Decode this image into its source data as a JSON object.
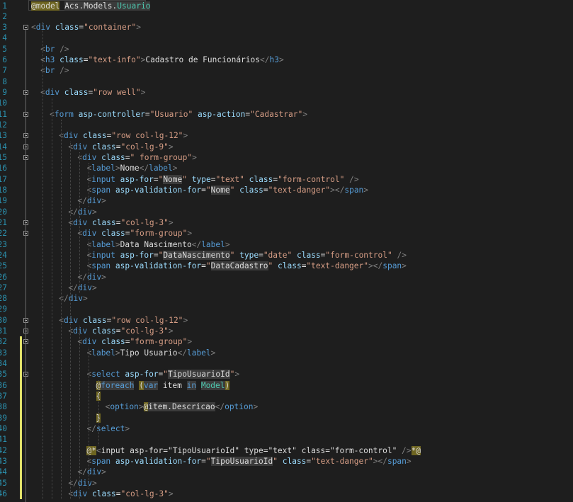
{
  "editor": {
    "line_numbers": [
      "1",
      "2",
      "3",
      "4",
      "5",
      "6",
      "7",
      "8",
      "9",
      "10",
      "11",
      "12",
      "13",
      "14",
      "15",
      "16",
      "17",
      "18",
      "19",
      "20",
      "21",
      "22",
      "23",
      "24",
      "25",
      "26",
      "27",
      "28",
      "29",
      "30",
      "31",
      "32",
      "33",
      "34",
      "35",
      "36",
      "37",
      "38",
      "39",
      "40",
      "41",
      "42",
      "43",
      "44",
      "45",
      "46"
    ],
    "lines": [
      [
        [
          "y",
          "@model"
        ],
        [
          "x",
          " "
        ],
        [
          "r",
          "Acs.Models."
        ],
        [
          "cr",
          "Usuario"
        ]
      ],
      [],
      [
        [
          "p",
          "<"
        ],
        [
          "t",
          "div"
        ],
        [
          "x",
          " "
        ],
        [
          "a",
          "class"
        ],
        [
          "x",
          "="
        ],
        [
          "s",
          "\"container\""
        ],
        [
          "p",
          ">"
        ]
      ],
      [],
      [
        [
          "p",
          "<"
        ],
        [
          "t",
          "br"
        ],
        [
          "x",
          " "
        ],
        [
          "p",
          "/>"
        ]
      ],
      [
        [
          "p",
          "<"
        ],
        [
          "t",
          "h3"
        ],
        [
          "x",
          " "
        ],
        [
          "a",
          "class"
        ],
        [
          "x",
          "="
        ],
        [
          "s",
          "\"text-info\""
        ],
        [
          "p",
          ">"
        ],
        [
          "x",
          "Cadastro de Funcionários"
        ],
        [
          "p",
          "</"
        ],
        [
          "t",
          "h3"
        ],
        [
          "p",
          ">"
        ]
      ],
      [
        [
          "p",
          "<"
        ],
        [
          "t",
          "br"
        ],
        [
          "x",
          " "
        ],
        [
          "p",
          "/>"
        ]
      ],
      [],
      [
        [
          "p",
          "<"
        ],
        [
          "t",
          "div"
        ],
        [
          "x",
          " "
        ],
        [
          "a",
          "class"
        ],
        [
          "x",
          "="
        ],
        [
          "s",
          "\"row well\""
        ],
        [
          "p",
          ">"
        ]
      ],
      [],
      [
        [
          "p",
          "<"
        ],
        [
          "t",
          "form"
        ],
        [
          "x",
          " "
        ],
        [
          "a",
          "asp-controller"
        ],
        [
          "x",
          "="
        ],
        [
          "s",
          "\"Usuario\""
        ],
        [
          "x",
          " "
        ],
        [
          "a",
          "asp-action"
        ],
        [
          "x",
          "="
        ],
        [
          "s",
          "\"Cadastrar\""
        ],
        [
          "p",
          ">"
        ]
      ],
      [],
      [
        [
          "p",
          "<"
        ],
        [
          "t",
          "div"
        ],
        [
          "x",
          " "
        ],
        [
          "a",
          "class"
        ],
        [
          "x",
          "="
        ],
        [
          "s",
          "\"row col-lg-12\""
        ],
        [
          "p",
          ">"
        ]
      ],
      [
        [
          "p",
          "<"
        ],
        [
          "t",
          "div"
        ],
        [
          "x",
          " "
        ],
        [
          "a",
          "class"
        ],
        [
          "x",
          "="
        ],
        [
          "s",
          "\"col-lg-9\""
        ],
        [
          "p",
          ">"
        ]
      ],
      [
        [
          "p",
          "<"
        ],
        [
          "t",
          "div"
        ],
        [
          "x",
          " "
        ],
        [
          "a",
          "class"
        ],
        [
          "x",
          "="
        ],
        [
          "s",
          "\" form-group\""
        ],
        [
          "p",
          ">"
        ]
      ],
      [
        [
          "p",
          "<"
        ],
        [
          "t",
          "label"
        ],
        [
          "p",
          ">"
        ],
        [
          "x",
          "Nome"
        ],
        [
          "p",
          "</"
        ],
        [
          "t",
          "label"
        ],
        [
          "p",
          ">"
        ]
      ],
      [
        [
          "p",
          "<"
        ],
        [
          "t",
          "input"
        ],
        [
          "x",
          " "
        ],
        [
          "a",
          "asp-for"
        ],
        [
          "x",
          "="
        ],
        [
          "s",
          "\""
        ],
        [
          "r",
          "Nome"
        ],
        [
          "s",
          "\""
        ],
        [
          "x",
          " "
        ],
        [
          "a",
          "type"
        ],
        [
          "x",
          "="
        ],
        [
          "s",
          "\"text\""
        ],
        [
          "x",
          " "
        ],
        [
          "a",
          "class"
        ],
        [
          "x",
          "="
        ],
        [
          "s",
          "\"form-control\""
        ],
        [
          "x",
          " "
        ],
        [
          "p",
          "/>"
        ]
      ],
      [
        [
          "p",
          "<"
        ],
        [
          "t",
          "span"
        ],
        [
          "x",
          " "
        ],
        [
          "a",
          "asp-validation-for"
        ],
        [
          "x",
          "="
        ],
        [
          "s",
          "\""
        ],
        [
          "r",
          "Nome"
        ],
        [
          "s",
          "\""
        ],
        [
          "x",
          " "
        ],
        [
          "a",
          "class"
        ],
        [
          "x",
          "="
        ],
        [
          "s",
          "\"text-danger\""
        ],
        [
          "p",
          "></"
        ],
        [
          "t",
          "span"
        ],
        [
          "p",
          ">"
        ]
      ],
      [
        [
          "p",
          "</"
        ],
        [
          "t",
          "div"
        ],
        [
          "p",
          ">"
        ]
      ],
      [
        [
          "p",
          "</"
        ],
        [
          "t",
          "div"
        ],
        [
          "p",
          ">"
        ]
      ],
      [
        [
          "p",
          "<"
        ],
        [
          "t",
          "div"
        ],
        [
          "x",
          " "
        ],
        [
          "a",
          "class"
        ],
        [
          "x",
          "="
        ],
        [
          "s",
          "\"col-lg-3\""
        ],
        [
          "p",
          ">"
        ]
      ],
      [
        [
          "p",
          "<"
        ],
        [
          "t",
          "div"
        ],
        [
          "x",
          " "
        ],
        [
          "a",
          "class"
        ],
        [
          "x",
          "="
        ],
        [
          "s",
          "\"form-group\""
        ],
        [
          "p",
          ">"
        ]
      ],
      [
        [
          "p",
          "<"
        ],
        [
          "t",
          "label"
        ],
        [
          "p",
          ">"
        ],
        [
          "x",
          "Data Nascimento"
        ],
        [
          "p",
          "</"
        ],
        [
          "t",
          "label"
        ],
        [
          "p",
          ">"
        ]
      ],
      [
        [
          "p",
          "<"
        ],
        [
          "t",
          "input"
        ],
        [
          "x",
          " "
        ],
        [
          "a",
          "asp-for"
        ],
        [
          "x",
          "="
        ],
        [
          "s",
          "\""
        ],
        [
          "r",
          "DataNascimento"
        ],
        [
          "s",
          "\""
        ],
        [
          "x",
          " "
        ],
        [
          "a",
          "type"
        ],
        [
          "x",
          "="
        ],
        [
          "s",
          "\"date\""
        ],
        [
          "x",
          " "
        ],
        [
          "a",
          "class"
        ],
        [
          "x",
          "="
        ],
        [
          "s",
          "\"form-control\""
        ],
        [
          "x",
          " "
        ],
        [
          "p",
          "/>"
        ]
      ],
      [
        [
          "p",
          "<"
        ],
        [
          "t",
          "span"
        ],
        [
          "x",
          " "
        ],
        [
          "a",
          "asp-validation-for"
        ],
        [
          "x",
          "="
        ],
        [
          "s",
          "\""
        ],
        [
          "r",
          "DataCadastro"
        ],
        [
          "s",
          "\""
        ],
        [
          "x",
          " "
        ],
        [
          "a",
          "class"
        ],
        [
          "x",
          "="
        ],
        [
          "s",
          "\"text-danger\""
        ],
        [
          "p",
          "></"
        ],
        [
          "t",
          "span"
        ],
        [
          "p",
          ">"
        ]
      ],
      [
        [
          "p",
          "</"
        ],
        [
          "t",
          "div"
        ],
        [
          "p",
          ">"
        ]
      ],
      [
        [
          "p",
          "</"
        ],
        [
          "t",
          "div"
        ],
        [
          "p",
          ">"
        ]
      ],
      [
        [
          "p",
          "</"
        ],
        [
          "t",
          "div"
        ],
        [
          "p",
          ">"
        ]
      ],
      [],
      [
        [
          "p",
          "<"
        ],
        [
          "t",
          "div"
        ],
        [
          "x",
          " "
        ],
        [
          "a",
          "class"
        ],
        [
          "x",
          "="
        ],
        [
          "s",
          "\"row col-lg-12\""
        ],
        [
          "p",
          ">"
        ]
      ],
      [
        [
          "p",
          "<"
        ],
        [
          "t",
          "div"
        ],
        [
          "x",
          " "
        ],
        [
          "a",
          "class"
        ],
        [
          "x",
          "="
        ],
        [
          "s",
          "\"col-lg-3\""
        ],
        [
          "p",
          ">"
        ]
      ],
      [
        [
          "p",
          "<"
        ],
        [
          "t",
          "div"
        ],
        [
          "x",
          " "
        ],
        [
          "a",
          "class"
        ],
        [
          "x",
          "="
        ],
        [
          "s",
          "\"form-group\""
        ],
        [
          "p",
          ">"
        ]
      ],
      [
        [
          "p",
          "<"
        ],
        [
          "t",
          "label"
        ],
        [
          "p",
          ">"
        ],
        [
          "x",
          "Tipo Usuario"
        ],
        [
          "p",
          "</"
        ],
        [
          "t",
          "label"
        ],
        [
          "p",
          ">"
        ]
      ],
      [],
      [
        [
          "p",
          "<"
        ],
        [
          "t",
          "select"
        ],
        [
          "x",
          " "
        ],
        [
          "a",
          "asp-for"
        ],
        [
          "x",
          "="
        ],
        [
          "s",
          "\""
        ],
        [
          "r",
          "TipoUsuarioId"
        ],
        [
          "s",
          "\""
        ],
        [
          "p",
          ">"
        ]
      ],
      [
        [
          "y",
          "@"
        ],
        [
          "k",
          "foreach"
        ],
        [
          "x",
          " "
        ],
        [
          "y",
          "("
        ],
        [
          "k",
          "var"
        ],
        [
          "x",
          " item "
        ],
        [
          "k",
          "in"
        ],
        [
          "x",
          " "
        ],
        [
          "cr",
          "Model"
        ],
        [
          "y",
          ")"
        ]
      ],
      [
        [
          "y",
          "{"
        ]
      ],
      [
        [
          "p",
          "<"
        ],
        [
          "t",
          "option"
        ],
        [
          "p",
          ">"
        ],
        [
          "y",
          "@"
        ],
        [
          "r",
          "item.Descricao"
        ],
        [
          "p",
          "</"
        ],
        [
          "t",
          "option"
        ],
        [
          "p",
          ">"
        ]
      ],
      [
        [
          "y",
          "}"
        ]
      ],
      [
        [
          "p",
          "</"
        ],
        [
          "t",
          "select"
        ],
        [
          "p",
          ">"
        ]
      ],
      [],
      [
        [
          "y",
          "@*"
        ],
        [
          "p",
          "<"
        ],
        [
          "x",
          "input asp-for=\"TipoUsuarioId\" type=\"text\" class=\"form-control\" "
        ],
        [
          "p",
          "/>"
        ],
        [
          "y",
          "*@"
        ]
      ],
      [
        [
          "p",
          "<"
        ],
        [
          "t",
          "span"
        ],
        [
          "x",
          " "
        ],
        [
          "a",
          "asp-validation-for"
        ],
        [
          "x",
          "="
        ],
        [
          "s",
          "\""
        ],
        [
          "r",
          "TipoUsuarioId"
        ],
        [
          "s",
          "\""
        ],
        [
          "x",
          " "
        ],
        [
          "a",
          "class"
        ],
        [
          "x",
          "="
        ],
        [
          "s",
          "\"text-danger\""
        ],
        [
          "p",
          "></"
        ],
        [
          "t",
          "span"
        ],
        [
          "p",
          ">"
        ]
      ],
      [
        [
          "p",
          "</"
        ],
        [
          "t",
          "div"
        ],
        [
          "p",
          ">"
        ]
      ],
      [
        [
          "p",
          "</"
        ],
        [
          "t",
          "div"
        ],
        [
          "p",
          ">"
        ]
      ],
      [
        [
          "p",
          "<"
        ],
        [
          "t",
          "div"
        ],
        [
          "x",
          " "
        ],
        [
          "a",
          "class"
        ],
        [
          "x",
          "="
        ],
        [
          "s",
          "\"col-lg-3\""
        ],
        [
          "p",
          ">"
        ]
      ]
    ]
  }
}
